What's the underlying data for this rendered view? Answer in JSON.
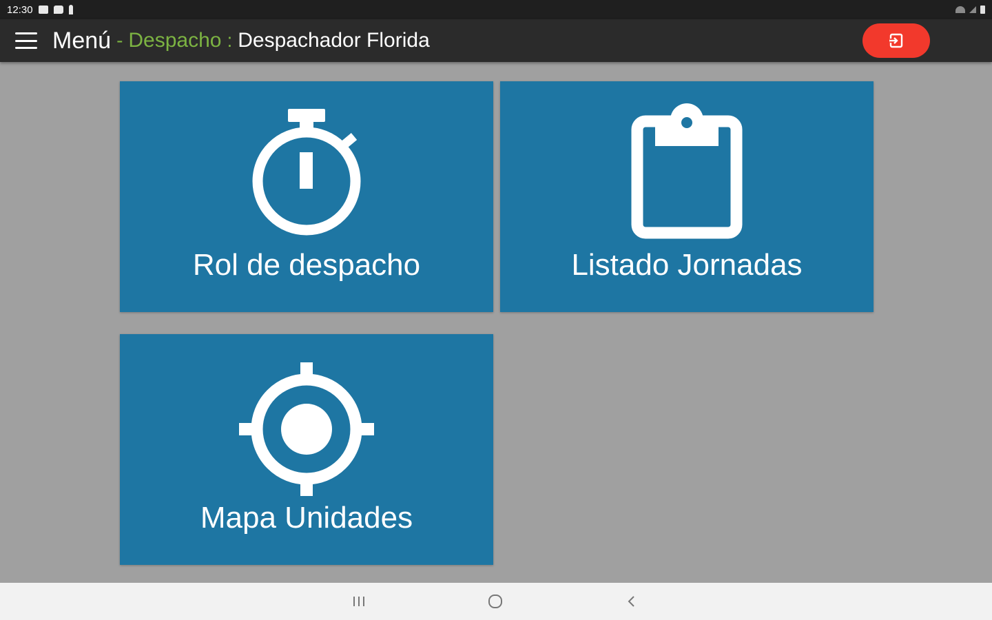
{
  "status_bar": {
    "time": "12:30",
    "left_icons": [
      "image-icon",
      "message-icon",
      "pin-icon"
    ],
    "right_icons": [
      "wifi-icon",
      "signal-icon",
      "battery-icon"
    ]
  },
  "app_bar": {
    "menu_icon": "hamburger-icon",
    "title": "Menú",
    "separator": "-",
    "section": "Despacho",
    "colon": ":",
    "user": "Despachador Florida",
    "logout_icon": "logout-icon"
  },
  "tiles": [
    {
      "label": "Rol de despacho",
      "icon": "stopwatch-icon"
    },
    {
      "label": "Listado Jornadas",
      "icon": "clipboard-icon"
    },
    {
      "label": "Mapa Unidades",
      "icon": "crosshair-icon"
    }
  ],
  "nav_bar": {
    "recents_icon": "recents-icon",
    "home_icon": "home-icon",
    "back_icon": "back-icon"
  },
  "colors": {
    "tile": "#1e76a3",
    "background": "#a0a0a0",
    "app_bar": "#2b2b2b",
    "accent_green": "#7cb342",
    "logout_red": "#f2392c"
  }
}
